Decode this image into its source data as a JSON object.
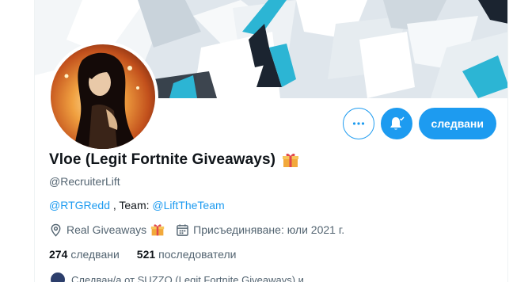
{
  "profile": {
    "display_name": "Vloe (Legit Fortnite Giveaways)",
    "handle": "@RecruiterLift",
    "name_badge_icon": "gift-icon",
    "bio": {
      "mention1": "@RTGRedd",
      "separator": " , Team: ",
      "mention2": "@LiftTheTeam"
    },
    "location": "Real Giveaways",
    "joined": "Присъединяване: юли 2021 г.",
    "following_count": "274",
    "following_label": "следвани",
    "followers_count": "521",
    "followers_label": "последователи",
    "followed_by": "Следван/а от SUZZO (Legit Fortnite Giveaways) и"
  },
  "actions": {
    "more_icon": "more-horizontal-icon",
    "bell_icon": "bell-subscribed-icon",
    "follow_label": "следвани"
  },
  "colors": {
    "accent": "#1d9bf0",
    "secondary_text": "#536471",
    "primary_text": "#0f1419"
  }
}
